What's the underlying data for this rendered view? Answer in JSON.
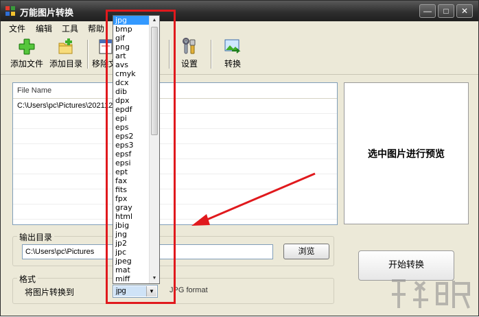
{
  "window": {
    "title": "万能图片转换",
    "minimize_glyph": "—",
    "maximize_glyph": "□",
    "close_glyph": "✕"
  },
  "menu": [
    "文件",
    "编辑",
    "工具",
    "帮助"
  ],
  "toolbar": {
    "add_file": "添加文件",
    "add_folder": "添加目录",
    "remove": "移除文",
    "settings": "设置",
    "convert": "转换"
  },
  "file_list": {
    "header": "File Name",
    "rows": [
      "C:\\Users\\pc\\Pictures\\202112"
    ]
  },
  "preview": {
    "placeholder": "选中图片进行预览"
  },
  "output": {
    "title": "输出目录",
    "path": "C:\\Users\\pc\\Pictures",
    "browse_label": "浏览"
  },
  "format": {
    "title": "格式",
    "convert_to_label": "将图片转换到",
    "selected": "jpg",
    "description": "JPG format",
    "options": [
      "jpg",
      "bmp",
      "gif",
      "png",
      "art",
      "avs",
      "cmyk",
      "dcx",
      "dib",
      "dpx",
      "epdf",
      "epi",
      "eps",
      "eps2",
      "eps3",
      "epsf",
      "epsi",
      "ept",
      "fax",
      "fits",
      "fpx",
      "gray",
      "html",
      "jbig",
      "jng",
      "jp2",
      "jpc",
      "jpeg",
      "mat",
      "miff"
    ]
  },
  "start_button": "开始转换",
  "colors": {
    "annotation_red": "#e0191d",
    "selected_blue": "#3399ff"
  },
  "icons": {
    "add_file": "green-plus-icon",
    "add_folder": "folder-plus-icon",
    "settings": "tools-icon",
    "convert": "image-convert-icon"
  }
}
